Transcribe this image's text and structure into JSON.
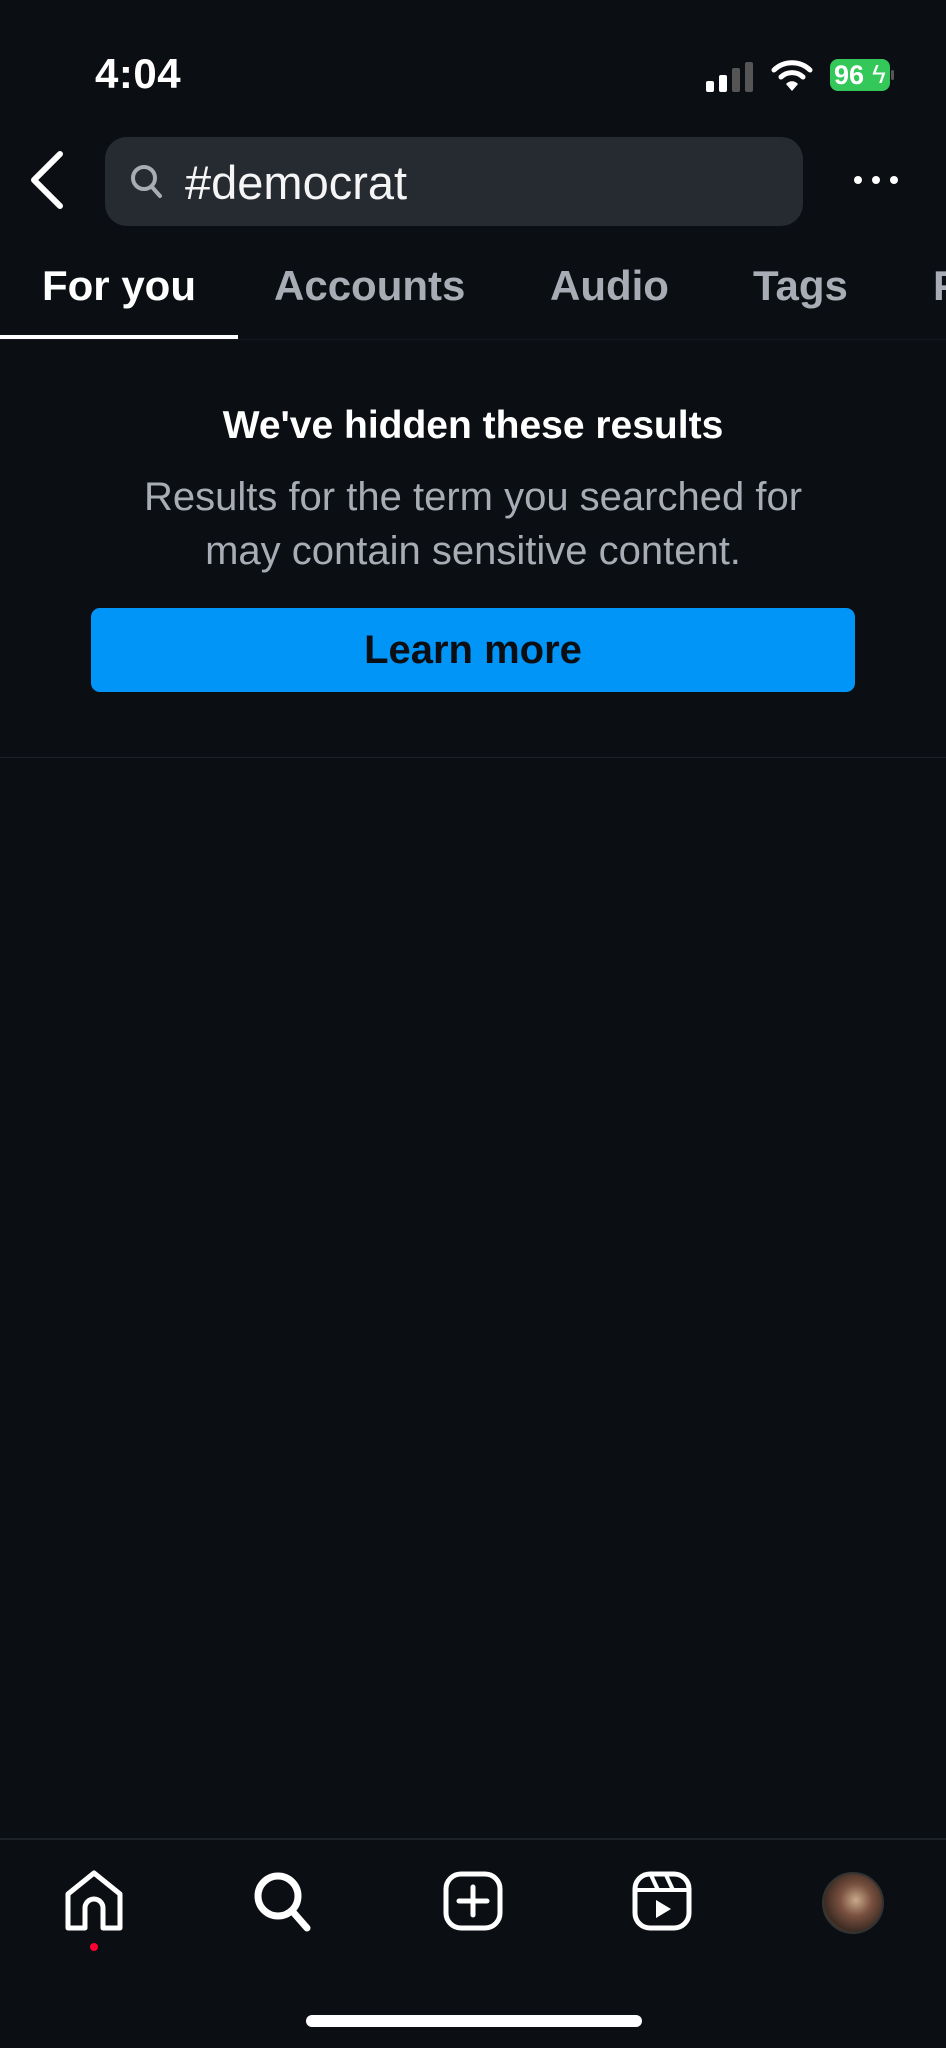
{
  "status_bar": {
    "time": "4:04",
    "battery": "96",
    "battery_color": "#34c759",
    "icons": [
      "signal-icon",
      "wifi-icon",
      "battery-charging-icon"
    ]
  },
  "header": {
    "search_value": "#democrat",
    "back_icon": "chevron-left-icon",
    "more_icon": "more-horizontal-icon"
  },
  "tabs": [
    {
      "label": "For you",
      "active": true
    },
    {
      "label": "Accounts",
      "active": false
    },
    {
      "label": "Audio",
      "active": false
    },
    {
      "label": "Tags",
      "active": false
    },
    {
      "label": "Places",
      "active": false
    }
  ],
  "notice": {
    "title": "We've hidden these results",
    "body_line1": "Results for the term you searched for",
    "body_line2": "may contain sensitive content.",
    "button": "Learn more",
    "button_color": "#0095f6"
  },
  "bottom_nav": {
    "items": [
      "home-icon",
      "search-icon",
      "create-icon",
      "reels-icon",
      "profile-avatar"
    ],
    "notification_dot_color": "#ff0033"
  }
}
